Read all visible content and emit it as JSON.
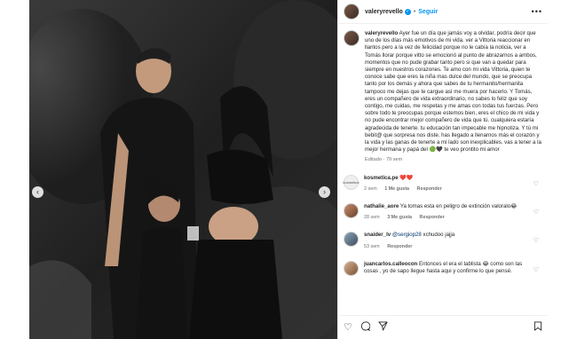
{
  "header": {
    "username": "valeryrevello",
    "separator": "•",
    "follow_label": "Seguir",
    "more_label": "•••"
  },
  "caption": {
    "author": "valeryrevello",
    "text": "Ayer fue un día que jamás voy a olvidar, podría decir que uno de los días más emotivos de mi vida. ver a Vittoria reaccionar en llantos pero a la vez de felicidad porque no le cabía la noticia, ver a Tomás llorar porque vitto se emocionó al punto de abrazarnos a ambos, momentos que no pude grabar tanto pero si que van a quedar para siempre en nuestros corazones. Te amo con mi vida Vittoria, quien te conoce sabe que eres la niña mas dulce del mundo, que se preocupa tanto por los demás y ahora que sabes de tu hermanito/hermanita tampoco me dejas que te cargue así me muera por hacerlo. Y Tomás, eres un compañero de vida extraordinario, no sabes lo feliz que soy contigo, me cuidas, me respetas y me amas con todas tus fuerzas. Pero sobre todo te preocupas porque estemos bien, eres el chico de mi vida y no pude encontrar mejor compañero de vida que tú. cualquiera estaría agradecida de tenerte. tu educación tan impecable me hipnotiza. Y tú mi bebit@ que sorpresa nos diste. has llegado a llenarnos más el corazón y la vida y las ganas de tenerte a mi lado son inexplicables. vas a tener a la mejor hermana y papá del 🟢🖤 te veo prontito mi amor",
    "meta": "Editado · 79 sem"
  },
  "comments": [
    {
      "author": "kosmetica.pe",
      "text": "❤️❤️",
      "time": "2 sem",
      "likes": "1 Me gusta",
      "reply": "Responder",
      "avatar_text": "kosmetica"
    },
    {
      "author": "nathalie_aore",
      "text": "Ya tomas esta en peligro de extinción valoralo😂",
      "time": "28 sem",
      "likes": "3 Me gusta",
      "reply": "Responder"
    },
    {
      "author": "snaider_lv",
      "tag": "@sergiop28",
      "text": "xchudoo jajja",
      "time": "53 sem",
      "likes": "",
      "reply": "Responder"
    },
    {
      "author": "juancarlos.calleocon",
      "text": "Entonces el era el tablista 😂 como son las cosas , yo de sapo llegue hasta aqui y confirme lo que pensé.",
      "time": "",
      "likes": "",
      "reply": ""
    }
  ],
  "carousel": {
    "prev_label": "‹",
    "next_label": "›"
  },
  "icons": {
    "like": "heart-icon",
    "comment": "comment-icon",
    "share": "share-icon",
    "save": "bookmark-icon",
    "verified": "verified-badge-icon"
  },
  "colors": {
    "accent": "#0095f6",
    "text": "#262626",
    "muted": "#737373"
  }
}
